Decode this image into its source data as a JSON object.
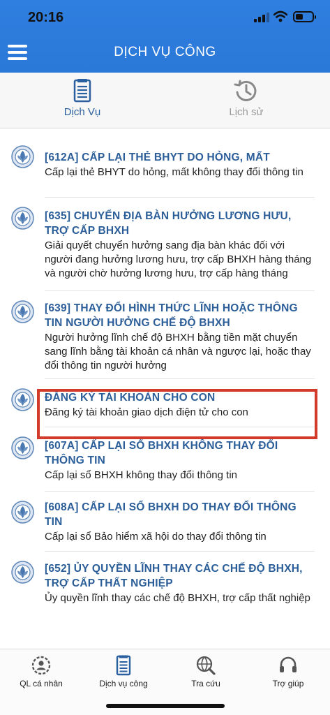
{
  "status_bar": {
    "time": "20:16",
    "battery_level": 0.45
  },
  "header": {
    "title": "DỊCH VỤ CÔNG",
    "menu_icon": "hamburger-icon"
  },
  "tabs": [
    {
      "label": "Dịch Vụ",
      "icon": "document-list-icon",
      "active": true
    },
    {
      "label": "Lịch sử",
      "icon": "history-icon",
      "active": false
    }
  ],
  "services": [
    {
      "title": "[612A] CẤP LẠI THẺ BHYT DO HỎNG, MẤT",
      "description": "Cấp lại thẻ BHYT do hỏng, mất không thay đổi thông tin"
    },
    {
      "title": "[635] CHUYỂN ĐỊA BÀN HƯỞNG LƯƠNG HƯU, TRỢ CẤP BHXH",
      "description": "Giải quyết chuyển hưởng sang địa bàn khác đối với người đang hưởng lương hưu, trợ cấp BHXH hàng tháng và người chờ hưởng lương hưu, trợ cấp hàng tháng"
    },
    {
      "title": "[639] THAY ĐỔI HÌNH THỨC LĨNH HOẶC THÔNG TIN NGƯỜI HƯỞNG CHẾ ĐỘ BHXH",
      "description": "Người hưởng lĩnh chế độ BHXH bằng tiền mặt chuyển sang lĩnh bằng tài khoản cá nhân và ngược lại, hoặc thay đổi thông tin người hưởng"
    },
    {
      "title": "ĐĂNG KÝ TÀI KHOẢN CHO CON",
      "description": "Đăng ký tài khoản giao dịch điện tử cho con"
    },
    {
      "title": "[607A] CẤP LẠI SỔ BHXH KHÔNG THAY ĐỔI THÔNG TIN",
      "description": "Cấp lại sổ BHXH không thay đổi thông tin"
    },
    {
      "title": "[608A] CẤP LẠI SỔ BHXH DO THAY ĐỔI THÔNG TIN",
      "description": "Cấp lại sổ Bảo hiểm xã hội do thay đổi thông tin"
    },
    {
      "title": "[652] ỦY QUYỀN LĨNH THAY CÁC CHẾ ĐỘ BHXH, TRỢ CẤP THẤT NGHIỆP",
      "description": "Ủy quyền lĩnh thay các chế độ BHXH, trợ cấp thất nghiệp"
    }
  ],
  "bottom_nav": [
    {
      "label": "QL cá nhân",
      "icon": "person-gear-icon"
    },
    {
      "label": "Dịch vụ công",
      "icon": "document-list-icon"
    },
    {
      "label": "Tra cứu",
      "icon": "globe-search-icon"
    },
    {
      "label": "Trợ giúp",
      "icon": "headset-icon"
    }
  ],
  "colors": {
    "header": "#2a78d8",
    "title_text": "#2b5e99",
    "highlight": "#d23a2a"
  }
}
